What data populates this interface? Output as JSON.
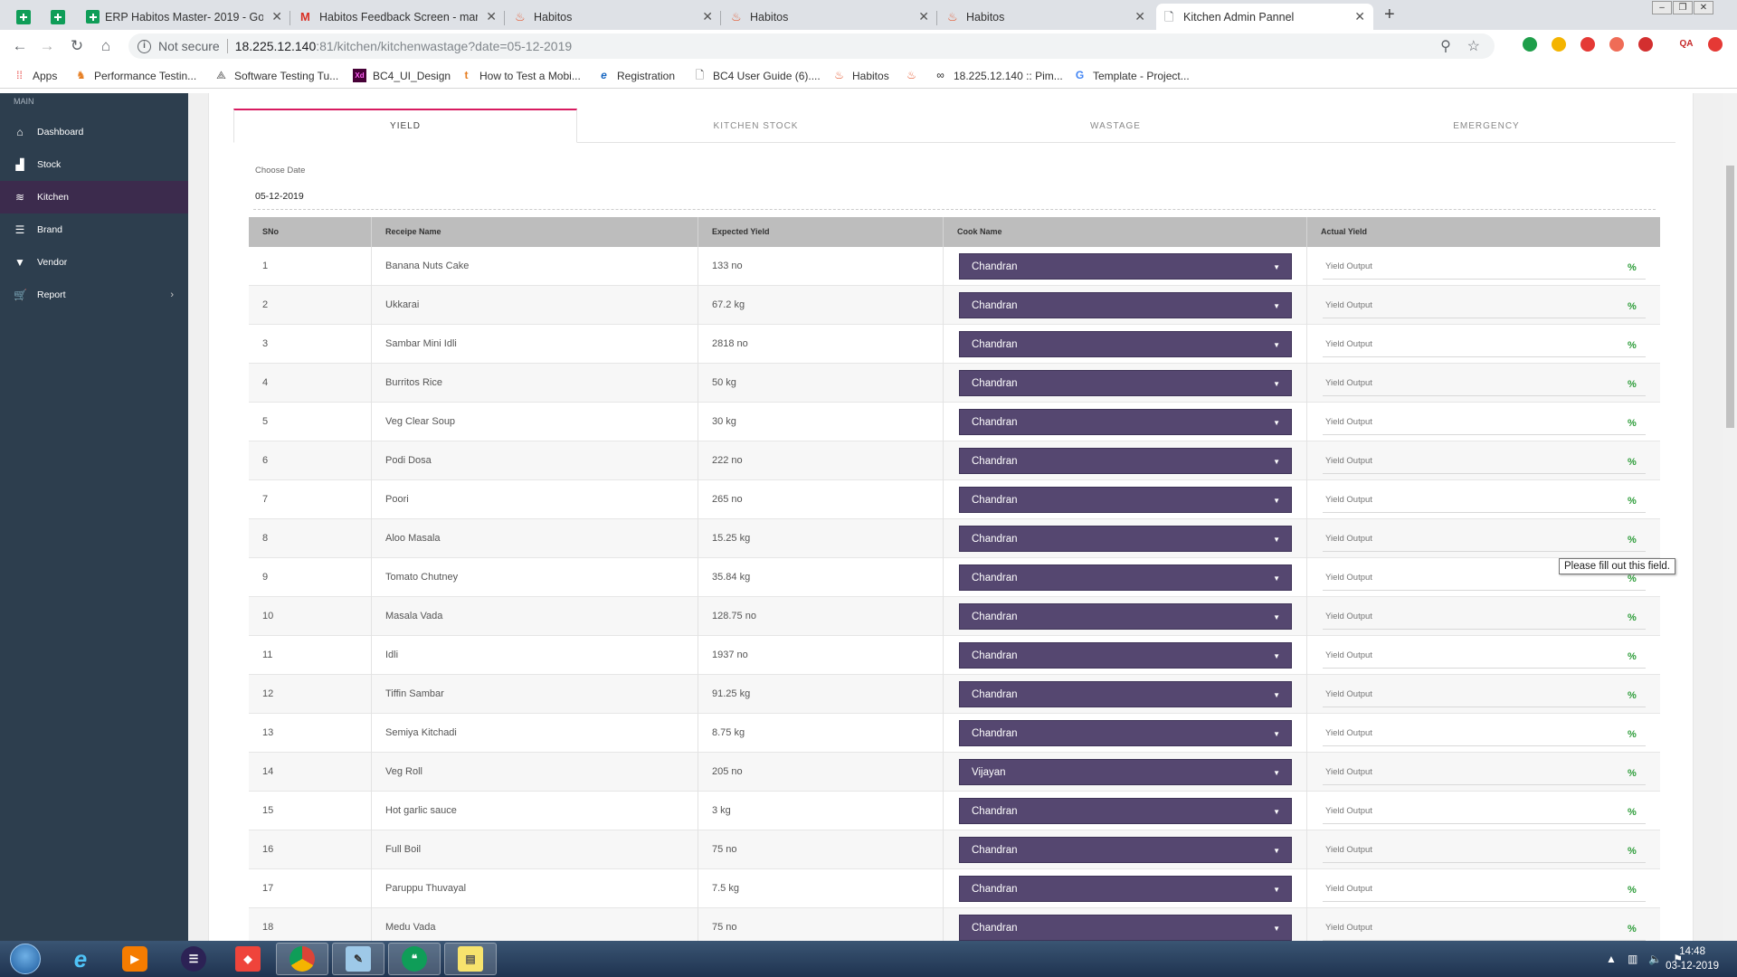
{
  "browser": {
    "tabs": [
      {
        "title": "ERP Habitos Master- 2019 - Goog",
        "icon": "sheets-icon"
      },
      {
        "title": "Habitos Feedback Screen - manil",
        "icon": "gmail-icon"
      },
      {
        "title": "Habitos",
        "icon": "habitos-icon"
      },
      {
        "title": "Habitos",
        "icon": "habitos-icon"
      },
      {
        "title": "Habitos",
        "icon": "habitos-icon"
      },
      {
        "title": "Kitchen Admin Pannel",
        "icon": "page-icon"
      }
    ],
    "address": {
      "not_secure": "Not secure",
      "host": "18.225.12.140",
      "path": ":81/kitchen/kitchenwastage?date=05-12-2019"
    },
    "bookmarks": [
      {
        "label": "Apps",
        "icon": "apps-icon"
      },
      {
        "label": "Performance Testin...",
        "icon": "lion-icon"
      },
      {
        "label": "Software Testing Tu...",
        "icon": "bookmark-icon"
      },
      {
        "label": "BC4_UI_Design",
        "icon": "xd-icon"
      },
      {
        "label": "How to Test a Mobi...",
        "icon": "t-icon"
      },
      {
        "label": "Registration",
        "icon": "e-icon"
      },
      {
        "label": "BC4 User Guide (6)....",
        "icon": "doc-icon"
      },
      {
        "label": "Habitos",
        "icon": "habitos-icon"
      },
      {
        "label": "",
        "icon": "habitos-icon"
      },
      {
        "label": "18.225.12.140 :: Pim...",
        "icon": "pimcore-icon"
      },
      {
        "label": "Template - Project...",
        "icon": "google-icon"
      }
    ]
  },
  "sidebar": {
    "section": "MAIN",
    "items": [
      {
        "label": "Dashboard",
        "icon": "home-icon"
      },
      {
        "label": "Stock",
        "icon": "bar-chart-icon"
      },
      {
        "label": "Kitchen",
        "icon": "layers-icon",
        "active": true
      },
      {
        "label": "Brand",
        "icon": "stack-icon"
      },
      {
        "label": "Vendor",
        "icon": "filter-icon"
      },
      {
        "label": "Report",
        "icon": "cart-icon"
      }
    ]
  },
  "tabs": [
    "YIELD",
    "KITCHEN STOCK",
    "WASTAGE",
    "EMERGENCY"
  ],
  "date": {
    "label": "Choose Date",
    "value": "05-12-2019"
  },
  "table": {
    "headers": [
      "SNo",
      "Receipe Name",
      "Expected Yield",
      "Cook Name",
      "Actual Yield"
    ],
    "placeholder": "Yield Output",
    "pct_symbol": "%",
    "rows": [
      {
        "sno": "1",
        "recipe": "Banana Nuts Cake",
        "expected": "133 no",
        "cook": "Chandran"
      },
      {
        "sno": "2",
        "recipe": "Ukkarai",
        "expected": "67.2 kg",
        "cook": "Chandran"
      },
      {
        "sno": "3",
        "recipe": "Sambar Mini Idli",
        "expected": "2818 no",
        "cook": "Chandran"
      },
      {
        "sno": "4",
        "recipe": "Burritos Rice",
        "expected": "50 kg",
        "cook": "Chandran"
      },
      {
        "sno": "5",
        "recipe": "Veg Clear Soup",
        "expected": "30 kg",
        "cook": "Chandran"
      },
      {
        "sno": "6",
        "recipe": "Podi Dosa",
        "expected": "222 no",
        "cook": "Chandran"
      },
      {
        "sno": "7",
        "recipe": "Poori",
        "expected": "265 no",
        "cook": "Chandran"
      },
      {
        "sno": "8",
        "recipe": "Aloo Masala",
        "expected": "15.25 kg",
        "cook": "Chandran"
      },
      {
        "sno": "9",
        "recipe": "Tomato Chutney",
        "expected": "35.84 kg",
        "cook": "Chandran"
      },
      {
        "sno": "10",
        "recipe": "Masala Vada",
        "expected": "128.75 no",
        "cook": "Chandran"
      },
      {
        "sno": "11",
        "recipe": "Idli",
        "expected": "1937 no",
        "cook": "Chandran"
      },
      {
        "sno": "12",
        "recipe": "Tiffin Sambar",
        "expected": "91.25 kg",
        "cook": "Chandran"
      },
      {
        "sno": "13",
        "recipe": "Semiya Kitchadi",
        "expected": "8.75 kg",
        "cook": "Chandran"
      },
      {
        "sno": "14",
        "recipe": "Veg Roll",
        "expected": "205 no",
        "cook": "Vijayan"
      },
      {
        "sno": "15",
        "recipe": "Hot garlic sauce",
        "expected": "3 kg",
        "cook": "Chandran"
      },
      {
        "sno": "16",
        "recipe": "Full Boil",
        "expected": "75 no",
        "cook": "Chandran"
      },
      {
        "sno": "17",
        "recipe": "Paruppu Thuvayal",
        "expected": "7.5 kg",
        "cook": "Chandran"
      },
      {
        "sno": "18",
        "recipe": "Medu Vada",
        "expected": "75 no",
        "cook": "Chandran"
      }
    ]
  },
  "tooltip": "Please fill out this field.",
  "taskbar": {
    "time": "14:48",
    "date": "03-12-2019"
  },
  "colors": {
    "accent": "#d81b60",
    "select_bg": "#554770",
    "sidebar_bg": "#2d3e4e",
    "sidebar_active": "#3c2b4d",
    "pct_green": "#2e9d3a"
  }
}
